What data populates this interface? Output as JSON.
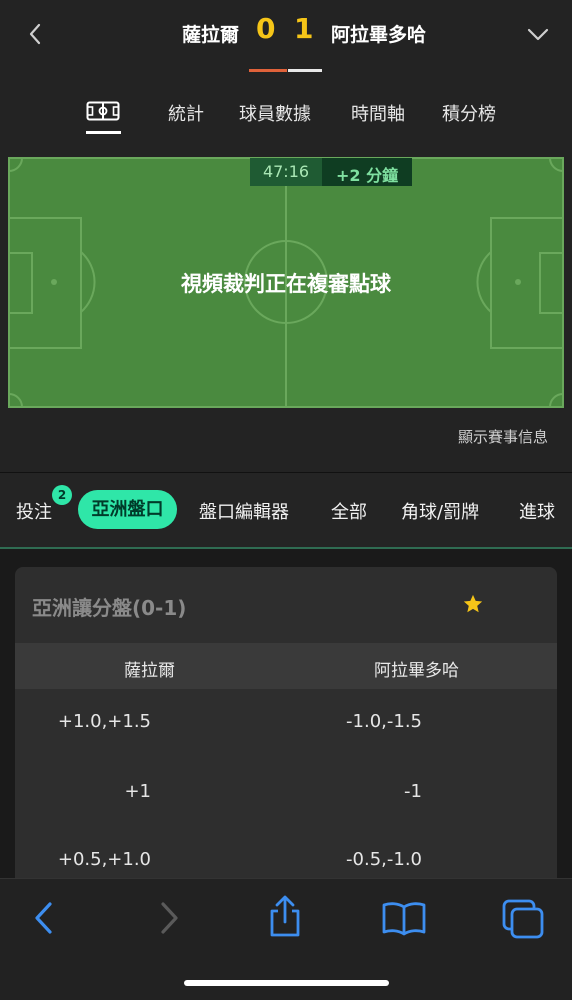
{
  "header": {
    "home_team": "薩拉爾",
    "away_team": "阿拉畢多哈",
    "home_score": "0",
    "away_score": "1"
  },
  "tabs": [
    {
      "label": "統計"
    },
    {
      "label": "球員數據"
    },
    {
      "label": "時間軸"
    },
    {
      "label": "積分榜"
    }
  ],
  "pitch": {
    "clock": "47:16",
    "added_time": "+2 分鐘",
    "status_text": "視頻裁判正在複審點球"
  },
  "match_info_link": "顯示賽事信息",
  "market_tabs": {
    "bets_label": "投注",
    "bets_badge": "2",
    "active_label": "亞洲盤口",
    "items": [
      "盤口編輯器",
      "全部",
      "角球/罰牌",
      "進球"
    ]
  },
  "odds_card": {
    "title": "亞洲讓分盤(0-1)",
    "home_header": "薩拉爾",
    "away_header": "阿拉畢多哈",
    "rows": [
      {
        "home": "+1.0,+1.5",
        "away": "-1.0,-1.5"
      },
      {
        "home": "+1",
        "away": "-1"
      },
      {
        "home": "+0.5,+1.0",
        "away": "-0.5,-1.0"
      }
    ]
  },
  "colors": {
    "accent": "#2fe6a8",
    "score": "#f5c518",
    "pitch": "#4a8a3f",
    "toolbar_icon": "#3d8ef0"
  },
  "icons": {
    "back": "chevron-left-icon",
    "collapse": "chevron-down-icon",
    "field": "pitch-icon",
    "favorite": "star-icon",
    "browser_back": "browser-back-icon",
    "browser_forward": "browser-forward-icon",
    "share": "share-icon",
    "bookmarks": "bookmarks-icon",
    "tabs": "tabs-icon"
  }
}
